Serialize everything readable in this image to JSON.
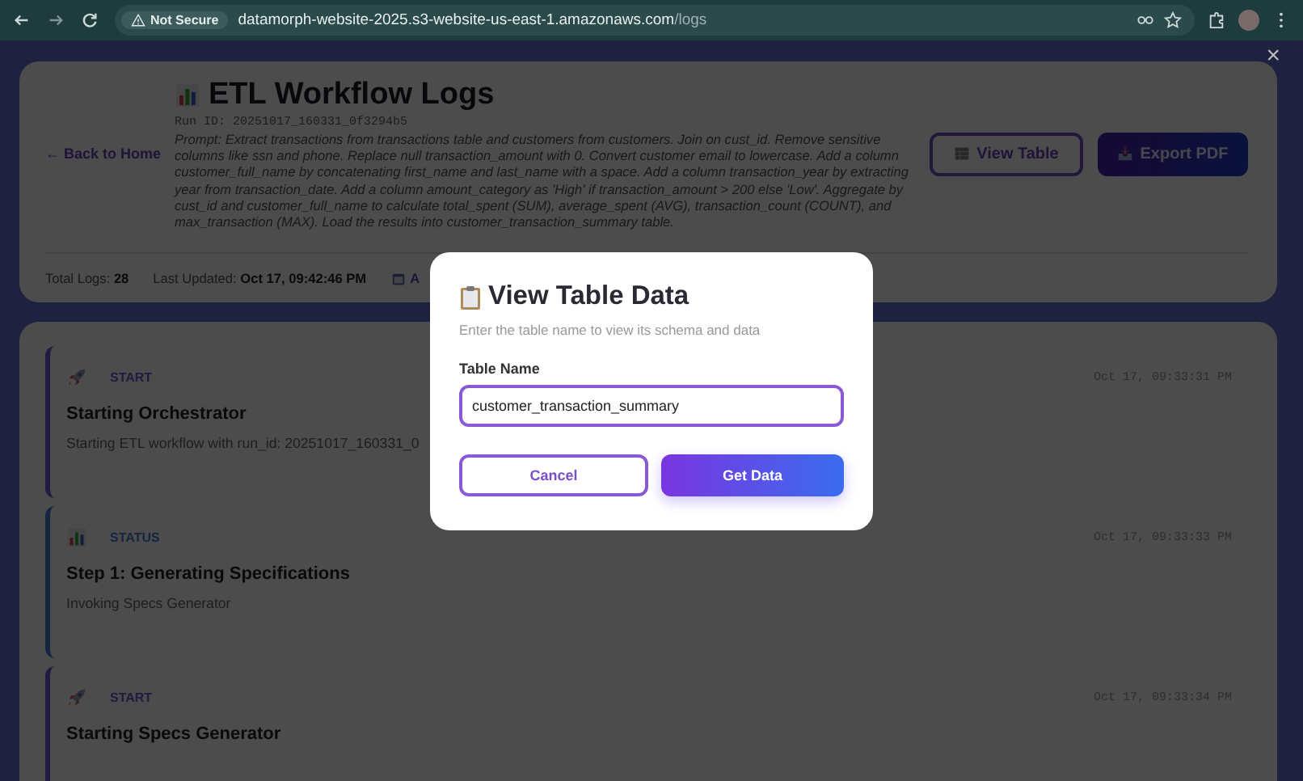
{
  "browser": {
    "security_label": "Not Secure",
    "url_host": "datamorph-website-2025.s3-website-us-east-1.amazonaws.com",
    "url_path": "/logs"
  },
  "header": {
    "back_link": "← Back to Home",
    "title": "ETL Workflow Logs",
    "run_id": "Run ID: 20251017_160331_0f3294b5",
    "prompt": "Prompt: Extract transactions from transactions table and customers from customers. Join on cust_id. Remove sensitive columns like ssn and phone. Replace null transaction_amount with 0. Convert customer email to lowercase. Add a column customer_full_name by concatenating first_name and last_name with a space. Add a column transaction_year by extracting year from transaction_date. Add a column amount_category as 'High' if transaction_amount > 200 else 'Low'. Aggregate by cust_id and customer_full_name to calculate total_spent (SUM), average_spent (AVG), transaction_count (COUNT), and max_transaction (MAX). Load the results into customer_transaction_summary table.",
    "buttons": [
      {
        "kind": "outline",
        "label": "View Table"
      },
      {
        "kind": "primary",
        "label": "Export PDF"
      }
    ],
    "stats": [
      {
        "kind": "value",
        "label": "Total Logs:",
        "value": "28"
      },
      {
        "kind": "value",
        "label": "Last Updated:",
        "value": "Oct 17, 09:42:46 PM"
      },
      {
        "kind": "icon",
        "label": "A"
      }
    ]
  },
  "logs": [
    {
      "kind": "start",
      "type": "START",
      "title": "Starting Orchestrator",
      "message": "Starting ETL workflow with run_id: 20251017_160331_0",
      "time": "Oct 17, 09:33:31 PM"
    },
    {
      "kind": "status",
      "type": "STATUS",
      "title": "Step 1: Generating Specifications",
      "message": "Invoking Specs Generator",
      "time": "Oct 17, 09:33:33 PM"
    },
    {
      "kind": "start",
      "type": "START",
      "title": "Starting Specs Generator",
      "time": "Oct 17, 09:33:34 PM"
    }
  ],
  "modal": {
    "title": "View Table Data",
    "subtitle": "Enter the table name to view its schema and data",
    "field_label": "Table Name",
    "field_value": "customer_transaction_summary",
    "cancel": "Cancel",
    "submit": "Get Data",
    "close": "×"
  }
}
